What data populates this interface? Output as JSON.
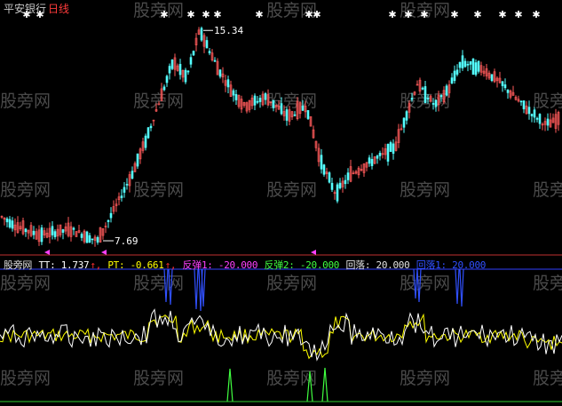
{
  "header": {
    "symbol": "平安银行",
    "period": "日线"
  },
  "watermark": "股旁网",
  "indicator_legend": {
    "name": "股旁网",
    "items": [
      {
        "label": "TT: 1.737",
        "arrow": "↑",
        "color": "#ffffff",
        "arrow_color": "#ff3030"
      },
      {
        "label": "PT: -0.661",
        "arrow": "↑",
        "color": "#ffff00",
        "arrow_color": "#ff3030"
      },
      {
        "label": "反弹1: -20.000",
        "arrow": "",
        "color": "#ff40ff",
        "arrow_color": ""
      },
      {
        "label": "反弹2: -20.000",
        "arrow": "",
        "color": "#40ff40",
        "arrow_color": ""
      },
      {
        "label": "回落: 20.000",
        "arrow": "",
        "color": "#e0e0e0",
        "arrow_color": ""
      },
      {
        "label": "回落1: 20.000",
        "arrow": "",
        "color": "#3050ff",
        "arrow_color": ""
      }
    ]
  },
  "colors": {
    "up": "#ff5a5a",
    "down": "#54ffff",
    "divider": "#c03030",
    "watermark": "#4a4a4a"
  },
  "chart_data": [
    {
      "type": "candlestick",
      "title": "平安银行 日线",
      "ylim": [
        7.4,
        15.8
      ],
      "annotations": [
        {
          "label": "15.34",
          "value": 15.34,
          "at": "peak"
        },
        {
          "label": "7.69",
          "value": 7.69,
          "at": "trough"
        }
      ],
      "top_markers": "white stars"
    },
    {
      "type": "line",
      "series": [
        {
          "name": "TT",
          "color": "#ffffff",
          "last": 1.737
        },
        {
          "name": "PT",
          "color": "#ffff00",
          "last": -0.661
        }
      ],
      "signals": [
        {
          "name": "反弹1",
          "value": -20.0,
          "color": "#ff40ff"
        },
        {
          "name": "反弹2",
          "value": -20.0,
          "color": "#40ff40"
        },
        {
          "name": "回落",
          "value": 20.0,
          "color": "#e0e0e0"
        },
        {
          "name": "回落1",
          "value": 20.0,
          "color": "#3050ff"
        }
      ]
    }
  ]
}
